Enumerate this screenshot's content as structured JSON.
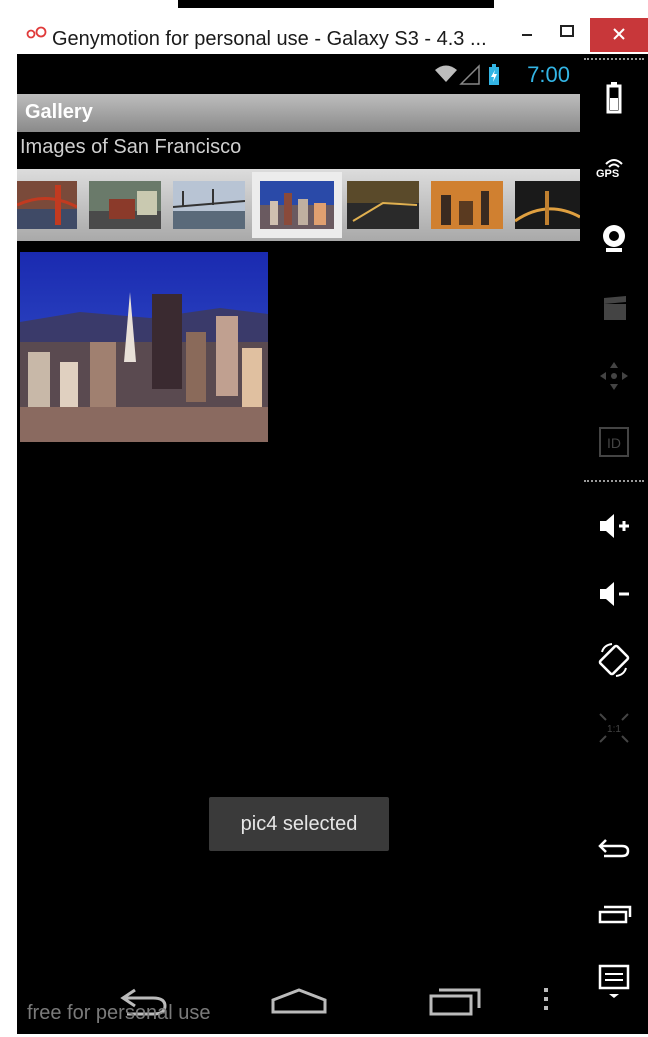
{
  "window": {
    "title": "Genymotion for personal use - Galaxy S3 - 4.3 ...",
    "minimize_icon": "minimize-icon",
    "maximize_icon": "maximize-icon",
    "close_icon": "close-icon"
  },
  "statusbar": {
    "time": "7:00",
    "icons": [
      "wifi-icon",
      "signal-icon",
      "battery-icon"
    ]
  },
  "app": {
    "actionbar_title": "Gallery",
    "caption": "Images of San Francisco",
    "gallery_items": [
      "golden-gate-bridge-thumb",
      "cable-car-thumb",
      "bay-bridge-thumb",
      "skyline-thumb",
      "city-night-thumb",
      "sunset-towers-thumb",
      "bridge-night-thumb"
    ],
    "selected_index": 3,
    "toast": "pic4 selected"
  },
  "navbar": {
    "icons": [
      "back-icon",
      "home-icon",
      "recent-apps-icon",
      "menu-icon"
    ],
    "watermark": "free for personal use"
  },
  "sidebar": {
    "gps_label": "GPS",
    "icons": [
      "battery-icon",
      "gps-icon",
      "camera-icon",
      "video-capture-icon",
      "dpad-icon",
      "device-id-icon",
      "volume-up-icon",
      "volume-down-icon",
      "rotate-icon",
      "pixel-perfect-icon",
      "back-icon",
      "recent-apps-icon",
      "menu-icon"
    ]
  },
  "colors": {
    "clock": "#33b5e5",
    "close_button": "#c8373a",
    "background": "#000000"
  }
}
